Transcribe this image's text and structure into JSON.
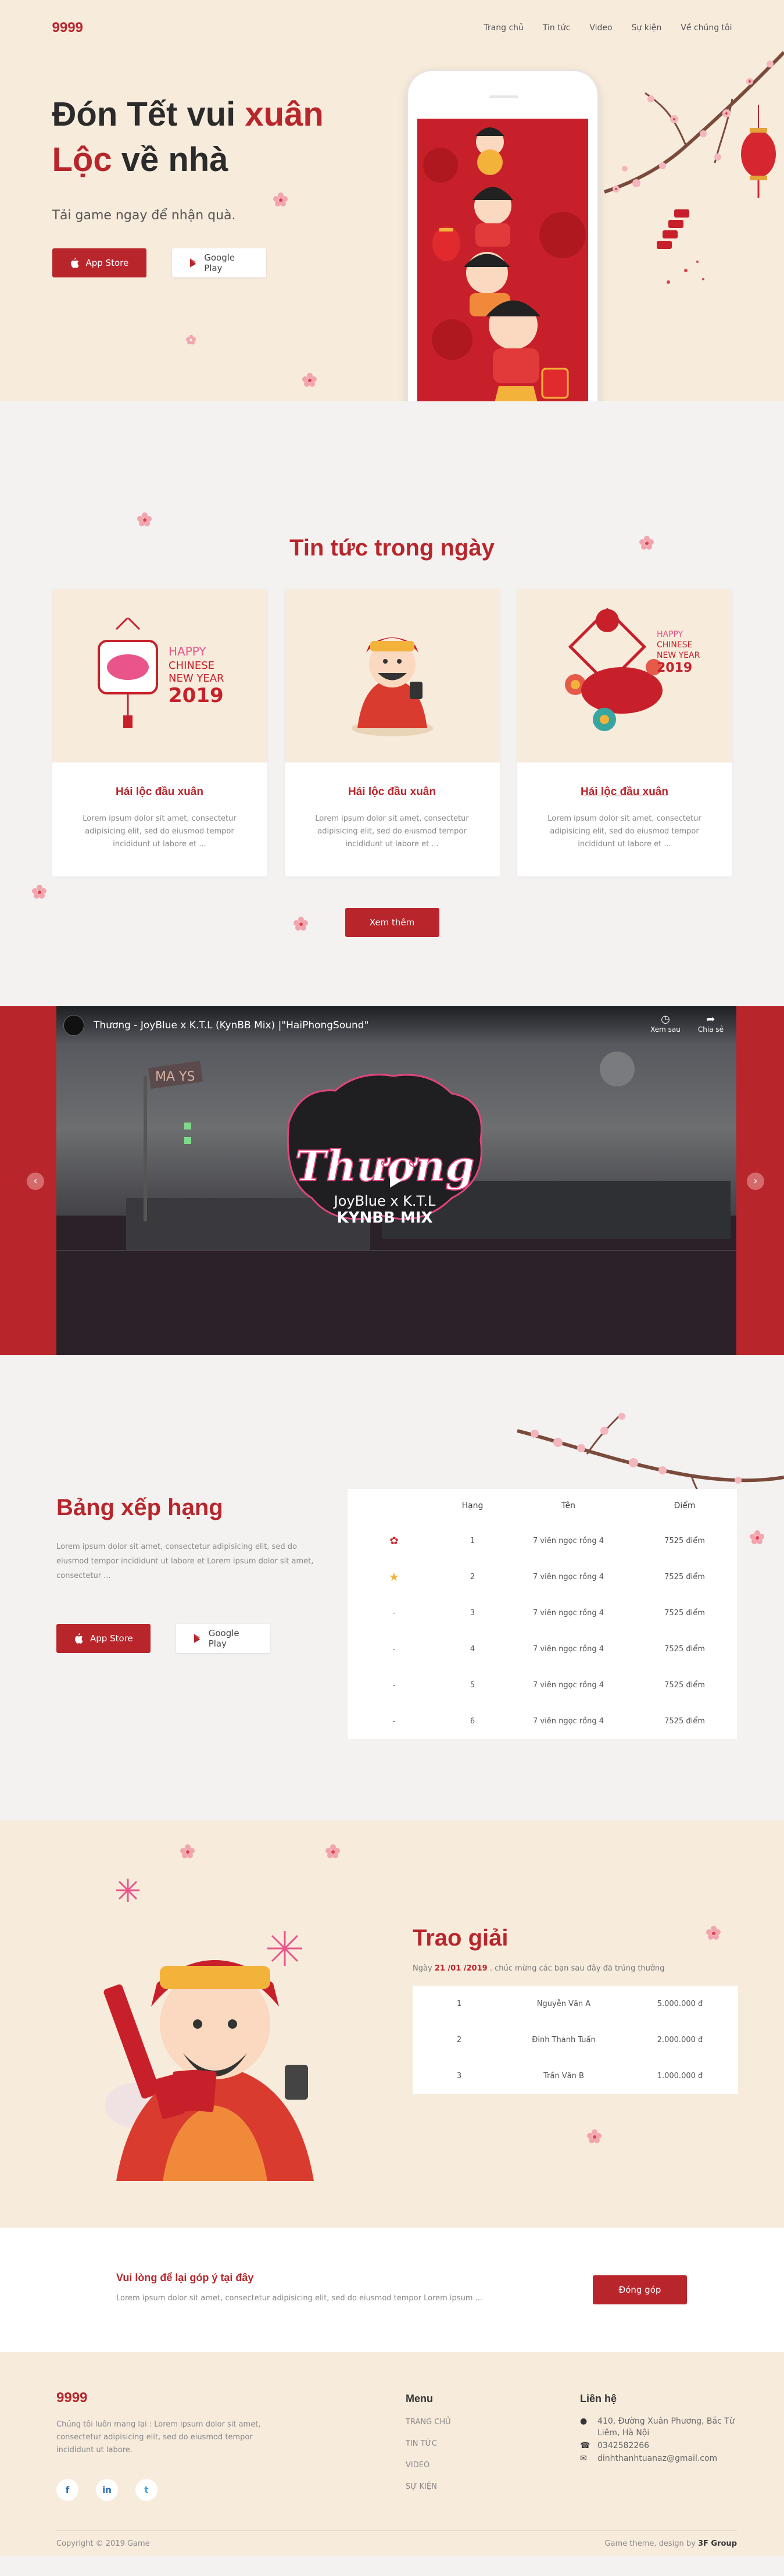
{
  "nav": {
    "logo": "9999",
    "items": [
      "Trang chủ",
      "Tin tức",
      "Video",
      "Sự kiện",
      "Về chúng tôi"
    ]
  },
  "hero": {
    "title_part1": "Đón Tết vui ",
    "title_red1": "xuân",
    "title_red2": "Lộc",
    "title_part2": " về nhà",
    "subtitle": "Tải game ngay để nhận quà.",
    "app_store": "App Store",
    "google_play": "Google Play"
  },
  "news": {
    "title": "Tin tức trong ngày",
    "card_art": {
      "year": "2019",
      "greeting": "HAPPY",
      "line2": "CHINESE",
      "line3": "NEW YEAR"
    },
    "cards": [
      {
        "title": "Hái lộc đầu xuân",
        "text": "Lorem ipsum dolor sit amet, consectetur adipisicing elit, sed do eiusmod tempor incididunt ut labore et ..."
      },
      {
        "title": "Hái lộc đầu xuân",
        "text": "Lorem ipsum dolor sit amet, consectetur adipisicing elit, sed do eiusmod tempor incididunt ut labore et ..."
      },
      {
        "title": "Hái lộc đầu xuân",
        "text": "Lorem ipsum dolor sit amet, consectetur adipisicing elit, sed do eiusmod tempor incididunt ut labore et ..."
      }
    ],
    "more": "Xem thêm"
  },
  "video": {
    "title": "Thương - JoyBlue x K.T.L (KynBB Mix) |\"HaiPhongSound\"",
    "watch_later": "Xem sau",
    "share": "Chia sẻ",
    "art_title": "Thương",
    "art_sub": "JoyBlue x K.T.L",
    "art_mix": "KYNBB MIX",
    "sign": "MA YS"
  },
  "ranking": {
    "title": "Bảng xếp hạng",
    "text": "Lorem ipsum dolor sit amet, consectetur adipisicing elit, sed do eiusmod tempor incididunt ut labore et Lorem ipsum dolor sit amet, consectetur ...",
    "app_store": "App Store",
    "google_play": "Google Play",
    "headers": [
      "Hạng",
      "Tên",
      "Điểm"
    ],
    "rows": [
      {
        "badge": "",
        "rank": "1",
        "name": "7 viên ngọc rồng 4",
        "score": "7525 điểm"
      },
      {
        "badge": "",
        "rank": "2",
        "name": "7 viên ngọc rồng 4",
        "score": "7525 điểm"
      },
      {
        "badge": "-",
        "rank": "3",
        "name": "7 viên ngọc rồng 4",
        "score": "7525 điểm"
      },
      {
        "badge": "-",
        "rank": "4",
        "name": "7 viên ngọc rồng 4",
        "score": "7525 điểm"
      },
      {
        "badge": "-",
        "rank": "5",
        "name": "7 viên ngọc rồng 4",
        "score": "7525 điểm"
      },
      {
        "badge": "-",
        "rank": "6",
        "name": "7 viên ngọc rồng 4",
        "score": "7525 điểm"
      }
    ]
  },
  "prize": {
    "title": "Trao giải",
    "date_prefix": "Ngày ",
    "date": "21 /01 /2019",
    "date_suffix": " . chúc mừng các bạn sau đây đã trúng thưởng",
    "rows": [
      {
        "rank": "1",
        "name": "Nguyễn Văn A",
        "amount": "5.000.000 đ"
      },
      {
        "rank": "2",
        "name": "Đinh Thanh Tuấn",
        "amount": "2.000.000 đ"
      },
      {
        "rank": "3",
        "name": "Trần Văn B",
        "amount": "1.000.000 đ"
      }
    ]
  },
  "feedback": {
    "title": "Vui lòng để lại góp ý tại đây",
    "text": "Lorem ipsum dolor sit amet, consectetur adipisicing elit, sed do eiusmod tempor Lorem ipsum ...",
    "button": "Đóng góp"
  },
  "footer": {
    "logo": "9999",
    "desc": "Chúng tôi luôn mang lại : Lorem ipsum dolor sit amet, consectetur adipisicing elit, sed do eiusmod tempor incididunt ut labore.",
    "social": [
      "f",
      "in",
      "t"
    ],
    "menu_title": "Menu",
    "menu": [
      "Trang chủ",
      "Tin tức",
      "Video",
      "Sự kiện"
    ],
    "contact_title": "Liên hệ",
    "address": "410, Đường Xuân Phương, Bắc Từ Liêm, Hà Nội",
    "phone": "0342582266",
    "email": "dinhthanhtuanaz@gmail.com",
    "copyright": "Copyright © 2019 Game",
    "credit_prefix": "Game theme, design by ",
    "credit": "3F Group"
  }
}
